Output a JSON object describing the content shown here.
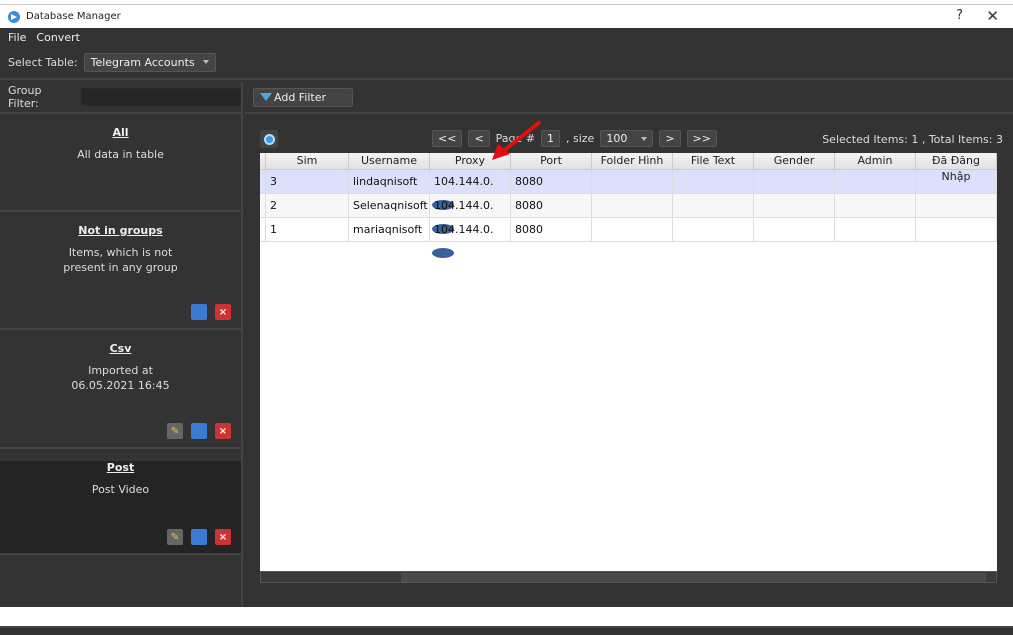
{
  "window": {
    "title": "Database Manager",
    "help": "?",
    "close": "✕"
  },
  "menu": [
    "File",
    "Convert"
  ],
  "toolbar": {
    "select_label": "Select Table:",
    "table_value": "Telegram Accounts"
  },
  "left": {
    "group_filter_label": "Group Filter:",
    "group_filter_value": "",
    "groups": [
      {
        "title": "All",
        "desc": "All data in table",
        "actions": []
      },
      {
        "title": "Not in groups",
        "desc": "Items, which is not present in any group",
        "actions": [
          "copy",
          "delete"
        ]
      },
      {
        "title": "Csv",
        "desc": "Imported at 06.05.2021 16:45",
        "actions": [
          "edit",
          "copy",
          "delete"
        ]
      },
      {
        "title": "Post",
        "desc": "Post Video",
        "actions": [
          "edit",
          "copy",
          "delete"
        ],
        "selected": true
      }
    ]
  },
  "filter": {
    "add_filter_label": "Add Filter"
  },
  "pager": {
    "first": "<<",
    "prev": "<",
    "page_label": "Page #",
    "page": "1",
    "size_label": ", size",
    "size": "100",
    "next": ">",
    "last": ">>"
  },
  "status": "Selected Items: 1 , Total Items: 3",
  "table": {
    "columns": [
      "Sim",
      "Username",
      "Proxy",
      "Port",
      "Folder Hình",
      "File Text",
      "Gender",
      "Admin",
      "Đã Đăng Nhập"
    ],
    "rows": [
      {
        "sim": "3",
        "username": "lindaqnisoft",
        "proxy": "104.144.0.",
        "port": "8080",
        "selected": true
      },
      {
        "sim": "2",
        "username": "Selenaqnisoft",
        "proxy": "104.144.0.",
        "port": "8080"
      },
      {
        "sim": "1",
        "username": "mariaqnisoft",
        "proxy": "104.144.0.",
        "port": "8080"
      }
    ]
  },
  "colors": {
    "annotation_arrow": "#e01010",
    "accent": "#3a8fd6"
  }
}
